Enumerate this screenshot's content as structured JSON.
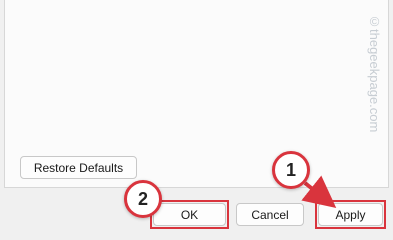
{
  "buttons": {
    "restore_defaults": "Restore Defaults",
    "ok": "OK",
    "cancel": "Cancel",
    "apply": "Apply"
  },
  "annotations": {
    "step1": "1",
    "step2": "2",
    "highlight_color": "#d9343d"
  },
  "watermark": "©thegeekpage.com"
}
